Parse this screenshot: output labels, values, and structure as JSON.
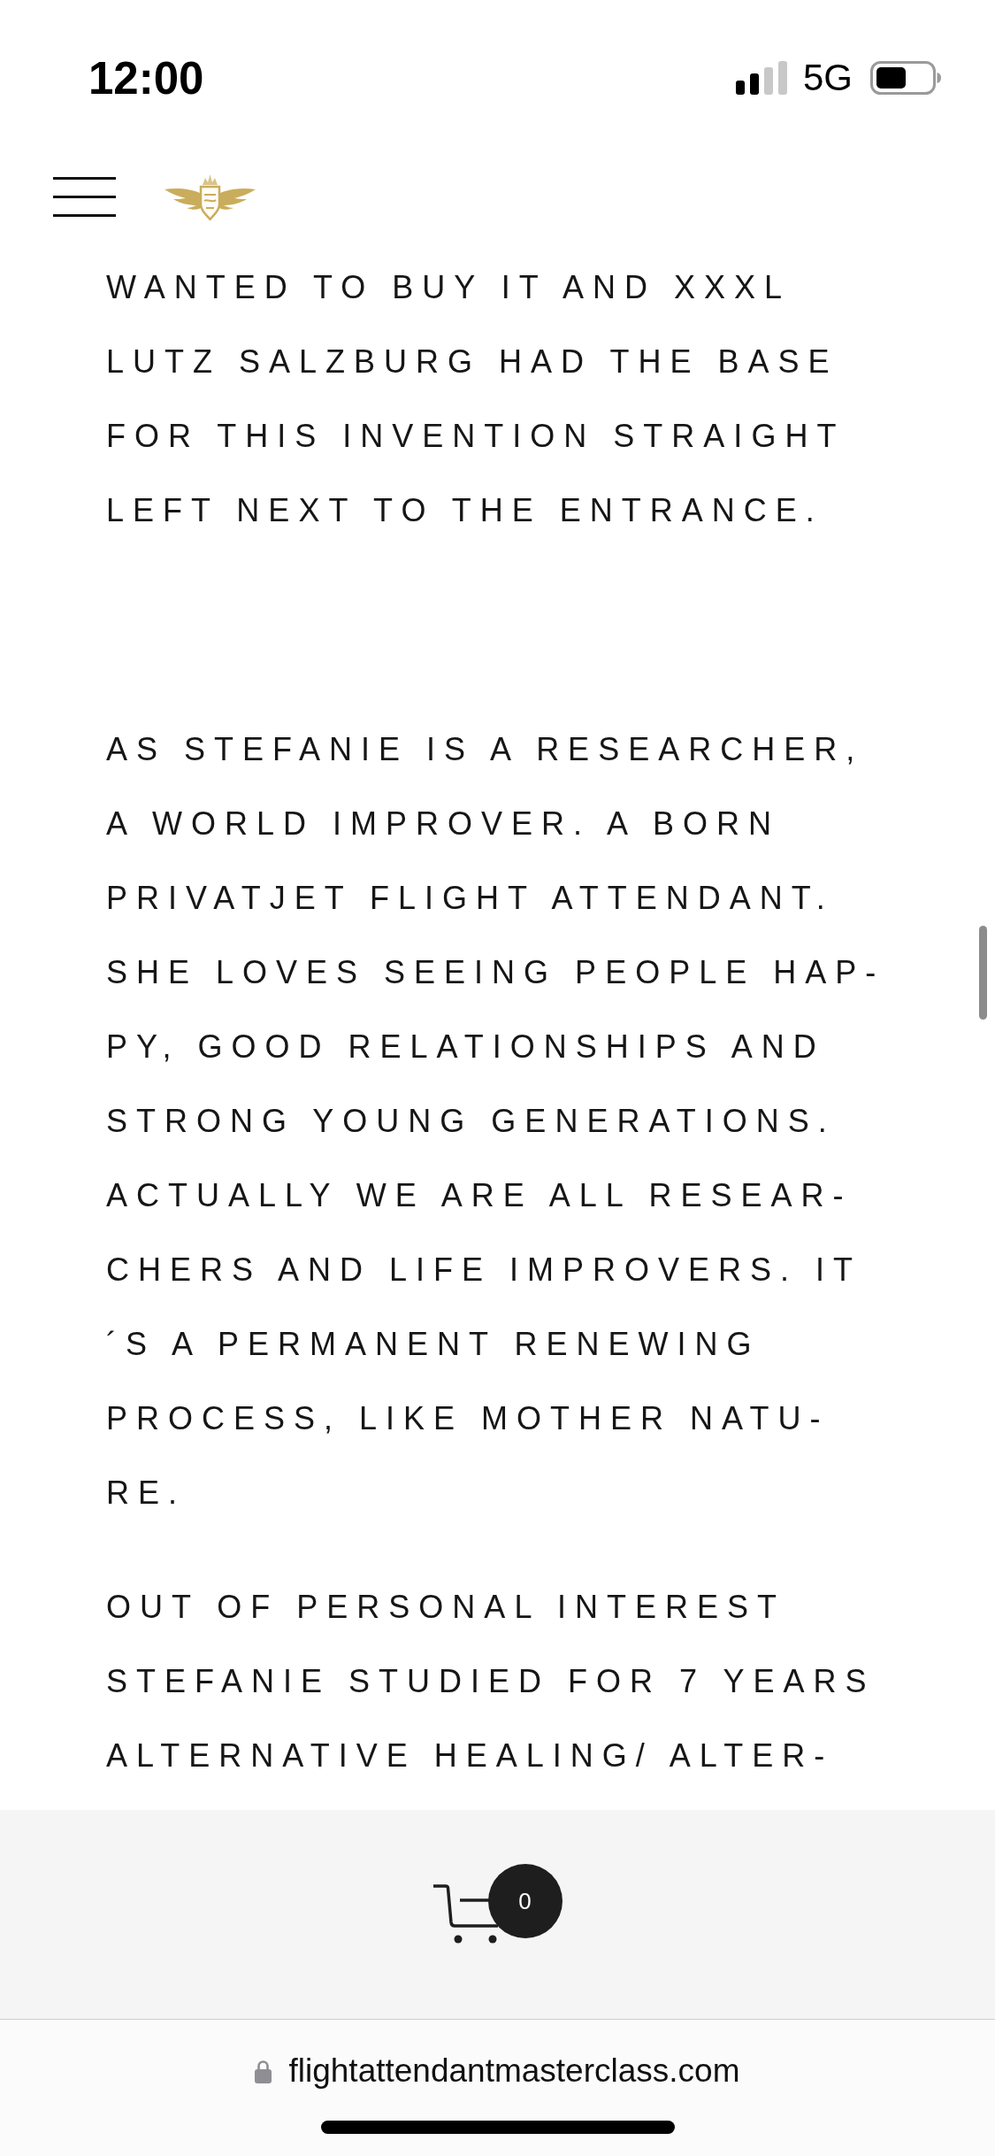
{
  "status_bar": {
    "time": "12:00",
    "network": "5G"
  },
  "article": {
    "paragraphs": [
      "WANTED TO BUY IT AND XXXL\nLUTZ SALZBURG HAD THE BASE\nFOR THIS INVENTION STRAIGHT\nLEFT NEXT TO THE ENTRANCE.",
      "AS STEFANIE IS A RESEARCHER,\nA WORLD IMPROVER. A BORN\nPRIVATJET FLIGHT ATTENDANT.\nSHE LOVES SEEING PEOPLE HAP-\nPY, GOOD RELATIONSHIPS AND\nSTRONG YOUNG GENERATIONS.\nACTUALLY WE ARE ALL RESEAR-\nCHERS AND LIFE IMPROVERS. IT\n´S A PERMANENT RENEWING\nPROCESS, LIKE MOTHER NATU-\nRE.",
      "OUT OF PERSONAL INTEREST\nSTEFANIE STUDIED FOR 7 YEARS\nALTERNATIVE HEALING/ ALTER-"
    ]
  },
  "cart": {
    "count": "0"
  },
  "browser_bar": {
    "url": "flightattendantmasterclass.com"
  }
}
